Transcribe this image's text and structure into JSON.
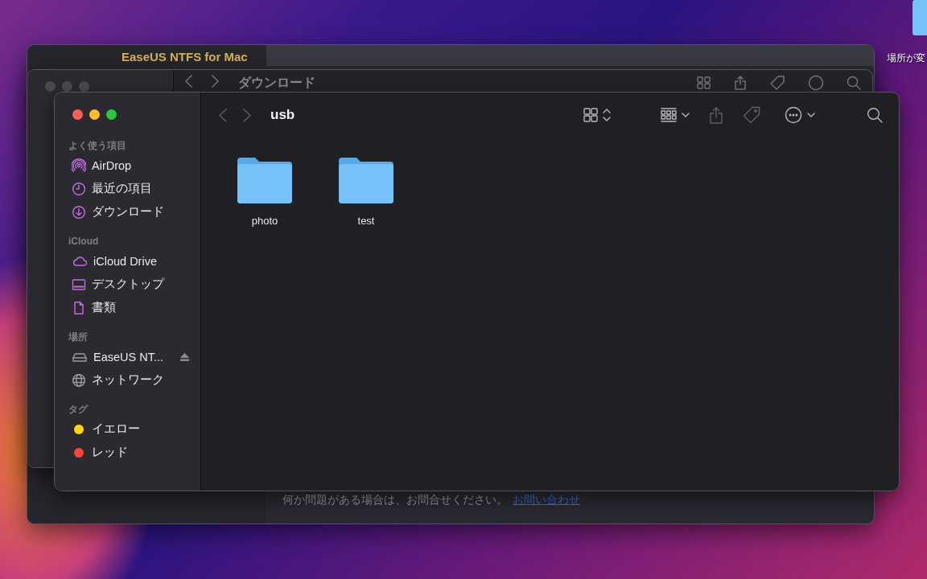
{
  "desktop": {
    "icon_label": "場所が変"
  },
  "back_app_window": {
    "title": "EaseUS NTFS for Mac",
    "footer_text": "何か問題がある場合は、お問合せください。",
    "footer_link": "お問い合わせ"
  },
  "back_finder": {
    "title": "ダウンロード"
  },
  "finder": {
    "title": "usb",
    "sidebar": [
      {
        "heading": "よく使う項目",
        "items": [
          {
            "label": "AirDrop",
            "kind": "airdrop",
            "selected": false
          },
          {
            "label": "最近の項目",
            "kind": "clock",
            "selected": false
          },
          {
            "label": "ダウンロード",
            "kind": "download",
            "selected": false
          }
        ]
      },
      {
        "heading": "iCloud",
        "items": [
          {
            "label": "iCloud Drive",
            "kind": "cloud",
            "selected": false
          },
          {
            "label": "デスクトップ",
            "kind": "desktop",
            "selected": false
          },
          {
            "label": "書類",
            "kind": "document",
            "selected": false
          }
        ]
      },
      {
        "heading": "場所",
        "items": [
          {
            "label": "EaseUS NT...",
            "kind": "drive",
            "selected": false,
            "eject": true
          },
          {
            "label": "ネットワーク",
            "kind": "network",
            "selected": false
          }
        ]
      },
      {
        "heading": "タグ",
        "items": [
          {
            "label": "イエロー",
            "kind": "tag",
            "color": "#ffd60a",
            "selected": false
          },
          {
            "label": "レッド",
            "kind": "tag",
            "color": "#ff453a",
            "selected": false
          }
        ]
      }
    ],
    "items": [
      {
        "name": "photo"
      },
      {
        "name": "test"
      }
    ]
  }
}
